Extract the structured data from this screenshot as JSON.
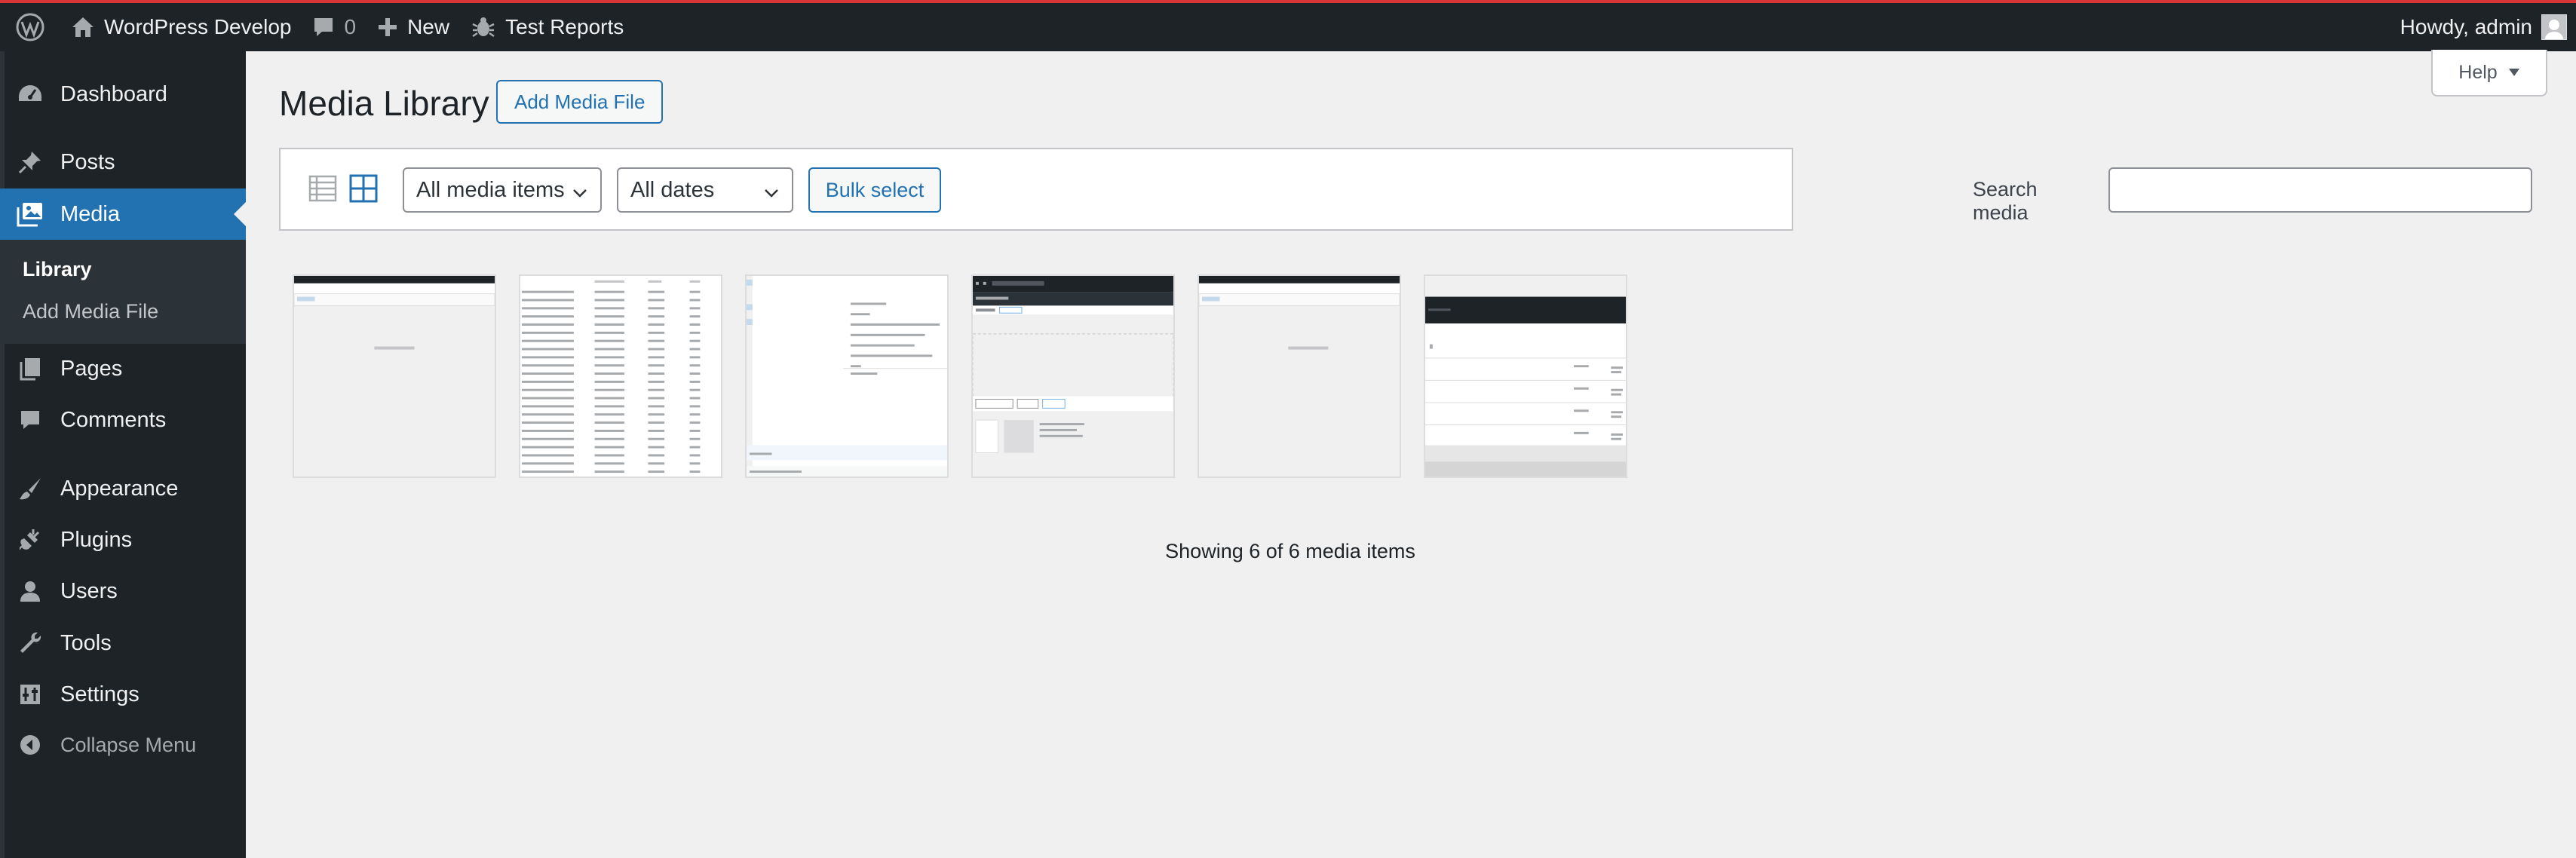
{
  "adminbar": {
    "site_name": "WordPress Develop",
    "comments_count": "0",
    "new_label": "New",
    "test_reports_label": "Test Reports",
    "howdy": "Howdy, admin"
  },
  "sidebar": {
    "items": [
      {
        "label": "Dashboard",
        "icon": "dashboard-icon"
      },
      {
        "label": "Posts",
        "icon": "pin-icon"
      },
      {
        "label": "Media",
        "icon": "media-icon"
      },
      {
        "label": "Pages",
        "icon": "pages-icon"
      },
      {
        "label": "Comments",
        "icon": "comment-icon"
      },
      {
        "label": "Appearance",
        "icon": "brush-icon"
      },
      {
        "label": "Plugins",
        "icon": "plugin-icon"
      },
      {
        "label": "Users",
        "icon": "user-icon"
      },
      {
        "label": "Tools",
        "icon": "wrench-icon"
      },
      {
        "label": "Settings",
        "icon": "settings-icon"
      }
    ],
    "submenu": [
      "Library",
      "Add Media File"
    ],
    "collapse_label": "Collapse Menu"
  },
  "main": {
    "title": "Media Library",
    "add_button": "Add Media File",
    "help_label": "Help",
    "filter_type": "All media items",
    "filter_date": "All dates",
    "bulk_select": "Bulk select",
    "search_label": "Search media",
    "search_value": "",
    "showing": "Showing 6 of 6 media items"
  },
  "colors": {
    "accent": "#2271b1",
    "adminbar_bg": "#1d2327",
    "top_line": "#d63638"
  }
}
